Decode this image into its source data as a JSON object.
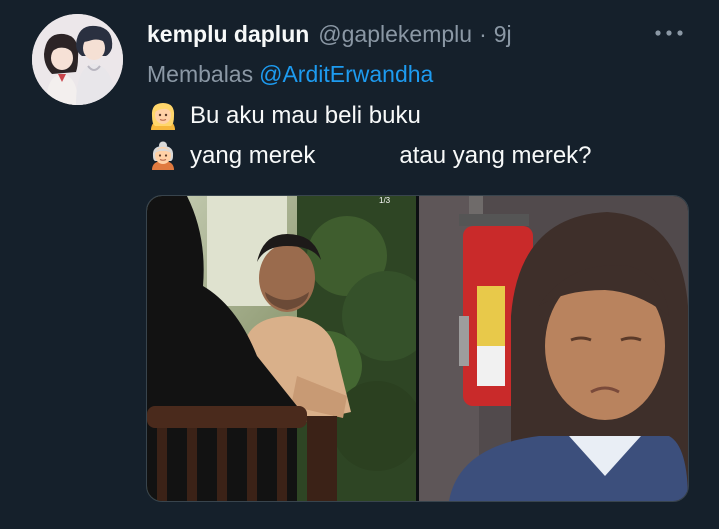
{
  "tweet": {
    "display_name": "kemplu daplun",
    "handle": "@gaplekemplu",
    "separator": "·",
    "time": "9j",
    "reply_prefix": "Membalas",
    "reply_to": "@ArditErwandha",
    "lines": [
      {
        "emoji": "person-blond-icon",
        "text": "Bu aku mau beli buku"
      },
      {
        "emoji": "older-woman-icon",
        "text_before": "yang merek",
        "text_after": "atau yang merek?"
      }
    ],
    "media": {
      "counter": "1/3",
      "photos": [
        "photo-man-sitting",
        "photo-woman-fire-extinguisher"
      ]
    }
  },
  "colors": {
    "background": "#15202b",
    "secondary_text": "#8b98a5",
    "link": "#1d9bf0",
    "primary_text": "#f7f9f9"
  }
}
